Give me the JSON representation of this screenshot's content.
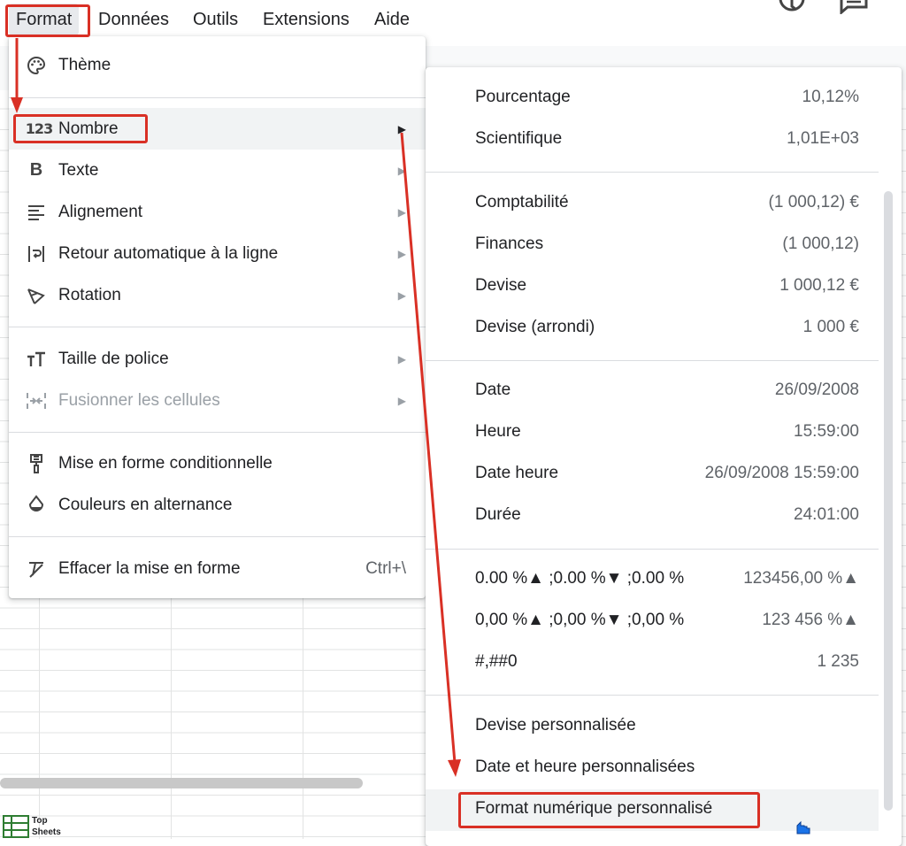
{
  "menubar": {
    "items": [
      "Format",
      "Données",
      "Outils",
      "Extensions",
      "Aide"
    ],
    "icons": [
      "history-icon",
      "comment-icon"
    ]
  },
  "format_menu": {
    "items": [
      {
        "label": "Thème",
        "icon": "palette-icon",
        "submenu": false
      },
      {
        "label": "Nombre",
        "icon": "number-123-icon",
        "submenu": true
      },
      {
        "label": "Texte",
        "icon": "bold-icon",
        "submenu": true
      },
      {
        "label": "Alignement",
        "icon": "align-left-icon",
        "submenu": true
      },
      {
        "label": "Retour automatique à la ligne",
        "icon": "text-wrap-icon",
        "submenu": true
      },
      {
        "label": "Rotation",
        "icon": "text-rotation-icon",
        "submenu": true
      },
      {
        "label": "Taille de police",
        "icon": "font-size-icon",
        "submenu": true
      },
      {
        "label": "Fusionner les cellules",
        "icon": "merge-cells-icon",
        "submenu": true,
        "disabled": true
      },
      {
        "label": "Mise en forme conditionnelle",
        "icon": "paint-roller-icon",
        "submenu": false
      },
      {
        "label": "Couleurs en alternance",
        "icon": "ink-drop-icon",
        "submenu": false
      },
      {
        "label": "Effacer la mise en forme",
        "icon": "clear-format-icon",
        "shortcut": "Ctrl+\\"
      }
    ]
  },
  "number_menu": {
    "items": [
      {
        "label": "Pourcentage",
        "value": "10,12%"
      },
      {
        "label": "Scientifique",
        "value": "1,01E+03"
      },
      {
        "label": "Comptabilité",
        "value": "(1 000,12) €"
      },
      {
        "label": "Finances",
        "value": "(1 000,12)"
      },
      {
        "label": "Devise",
        "value": "1 000,12 €"
      },
      {
        "label": "Devise (arrondi)",
        "value": "1 000 €"
      },
      {
        "label": "Date",
        "value": "26/09/2008"
      },
      {
        "label": "Heure",
        "value": "15:59:00"
      },
      {
        "label": "Date heure",
        "value": "26/09/2008 15:59:00"
      },
      {
        "label": "Durée",
        "value": "24:01:00"
      },
      {
        "label": "0.00 %▲ ;0.00 %▼ ;0.00 %",
        "value": "123456,00 %▲"
      },
      {
        "label": "0,00 %▲ ;0,00 %▼ ;0,00 %",
        "value": "123 456 %▲"
      },
      {
        "label": "#,##0",
        "value": "1 235"
      },
      {
        "label": "Devise personnalisée",
        "value": ""
      },
      {
        "label": "Date et heure personnalisées",
        "value": ""
      },
      {
        "label": "Format numérique personnalisé",
        "value": ""
      }
    ]
  },
  "logo": {
    "line1": "Top",
    "line2": "Sheets"
  },
  "colors": {
    "highlight": "#d93025",
    "hover": "#f1f3f4",
    "cursor": "#1a73e8"
  }
}
